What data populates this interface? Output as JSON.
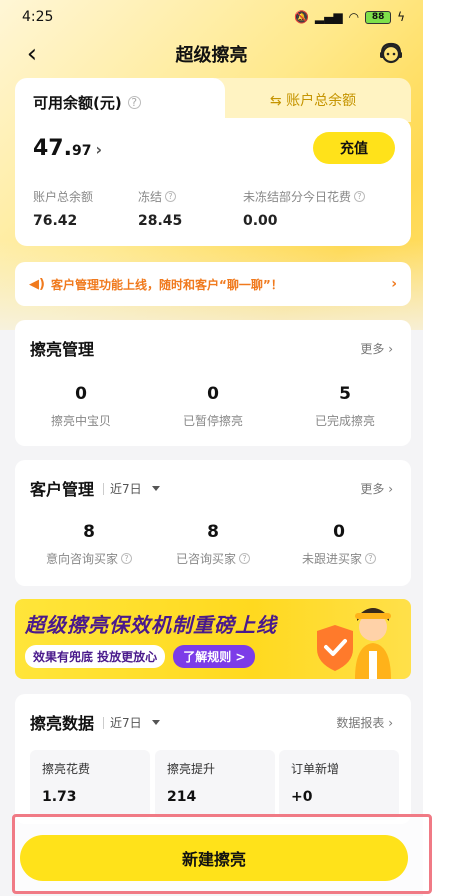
{
  "status_bar": {
    "time": "4:25",
    "battery": "88"
  },
  "nav": {
    "title": "超级擦亮"
  },
  "balance": {
    "tab_available": "可用余额(元)",
    "tab_total": "⇆ 账户总余额",
    "amount_int": "47.",
    "amount_dec": "97",
    "recharge_label": "充值",
    "stats": [
      {
        "label": "账户总余额",
        "value": "76.42"
      },
      {
        "label": "冻结",
        "value": "28.45"
      },
      {
        "label": "未冻结部分今日花费",
        "value": "0.00"
      }
    ]
  },
  "notice": {
    "text": "客户管理功能上线，随时和客户“聊一聊”！"
  },
  "polish_mgmt": {
    "title": "擦亮管理",
    "more": "更多",
    "stats": [
      {
        "num": "0",
        "label": "擦亮中宝贝"
      },
      {
        "num": "0",
        "label": "已暂停擦亮"
      },
      {
        "num": "5",
        "label": "已完成擦亮"
      }
    ]
  },
  "customer_mgmt": {
    "title": "客户管理",
    "period": "近7日",
    "more": "更多",
    "stats": [
      {
        "num": "8",
        "label": "意向咨询买家"
      },
      {
        "num": "8",
        "label": "已咨询买家"
      },
      {
        "num": "0",
        "label": "未跟进买家"
      }
    ]
  },
  "banner": {
    "title": "超级擦亮保效机制重磅上线",
    "subtitle": "效果有兜底  投放更放心",
    "button": "了解规则 >"
  },
  "polish_data": {
    "title": "擦亮数据",
    "period": "近7日",
    "report": "数据报表",
    "tiles": [
      {
        "label": "擦亮花费",
        "value": "1.73"
      },
      {
        "label": "擦亮提升",
        "value": "214"
      },
      {
        "label": "订单新增",
        "value": "+0"
      }
    ]
  },
  "bottom": {
    "create_label": "新建擦亮"
  },
  "colors": {
    "accent": "#ffe21a",
    "notice": "#f07a1e",
    "banner_purple": "#7c3ce8"
  }
}
